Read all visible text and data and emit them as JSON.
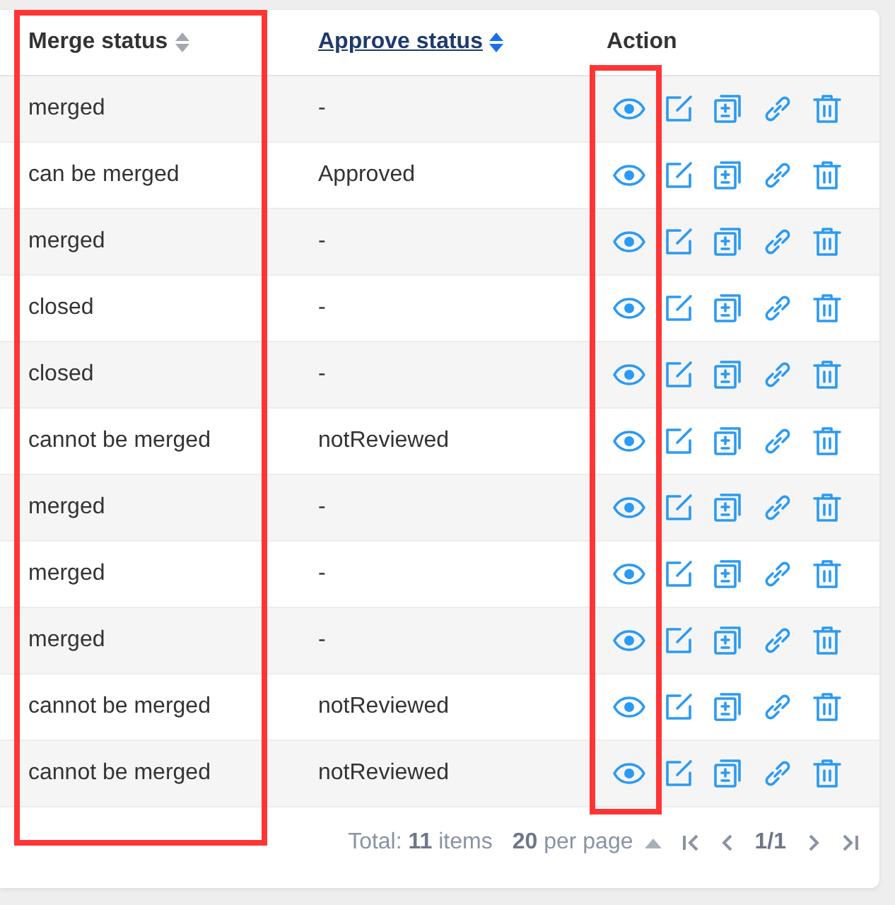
{
  "table": {
    "columns": [
      {
        "label": "Merge status",
        "sortable": true,
        "sorted": false
      },
      {
        "label": "Approve status",
        "sortable": true,
        "sorted": true
      },
      {
        "label": "Action",
        "sortable": false
      }
    ],
    "rows": [
      {
        "merge_status": "merged",
        "approve_status": "-"
      },
      {
        "merge_status": "can be merged",
        "approve_status": "Approved"
      },
      {
        "merge_status": "merged",
        "approve_status": "-"
      },
      {
        "merge_status": "closed",
        "approve_status": "-"
      },
      {
        "merge_status": "closed",
        "approve_status": "-"
      },
      {
        "merge_status": "cannot be merged",
        "approve_status": "notReviewed"
      },
      {
        "merge_status": "merged",
        "approve_status": "-"
      },
      {
        "merge_status": "merged",
        "approve_status": "-"
      },
      {
        "merge_status": "merged",
        "approve_status": "-"
      },
      {
        "merge_status": "cannot be merged",
        "approve_status": "notReviewed"
      },
      {
        "merge_status": "cannot be merged",
        "approve_status": "notReviewed"
      }
    ]
  },
  "pagination": {
    "total": "Total: **11** items",
    "page_size": "**20** per page",
    "page": "1/1"
  }
}
